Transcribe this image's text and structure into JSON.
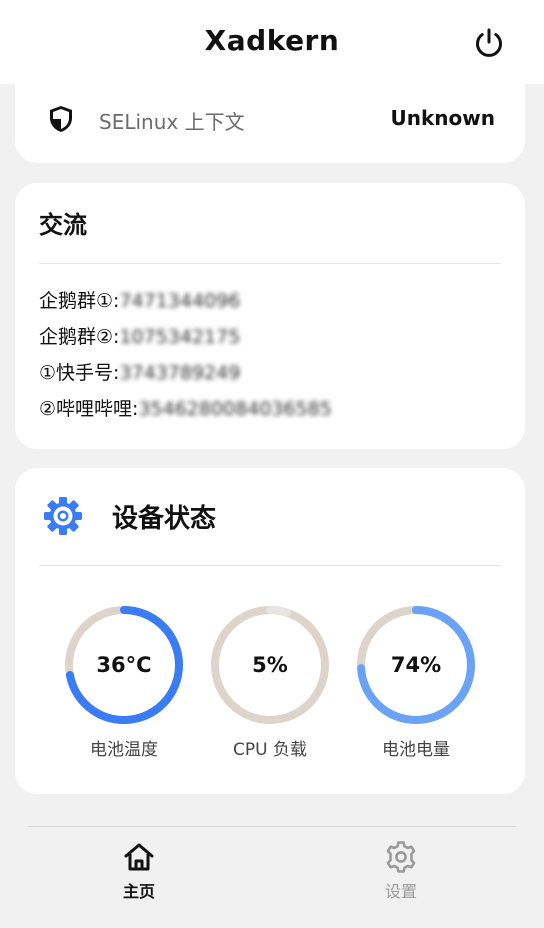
{
  "app": {
    "title": "Xadkern"
  },
  "selinux": {
    "label": "SELinux 上下文",
    "value": "Unknown",
    "icon": "shield-icon"
  },
  "communication": {
    "title": "交流",
    "items": [
      {
        "label": "企鹅群①:",
        "value": "7471344096"
      },
      {
        "label": "企鹅群②:",
        "value": "1075342175"
      },
      {
        "label": "①快手号:",
        "value": "3743789249"
      },
      {
        "label": "②哔哩哔哩:",
        "value": "3546280084036585"
      }
    ]
  },
  "device_status": {
    "title": "设备状态",
    "icon": "gear-icon",
    "gauges": [
      {
        "label": "电池温度",
        "display": "36°C",
        "fraction": 0.72,
        "color": "#3a7cf3",
        "track": "#ddd4cc"
      },
      {
        "label": "CPU 负载",
        "display": "5%",
        "fraction": 0.05,
        "color": "#e8e4e1",
        "track": "#ddd4cc"
      },
      {
        "label": "电池电量",
        "display": "74%",
        "fraction": 0.74,
        "color": "#6aa3f6",
        "track": "#ddd4cc"
      }
    ]
  },
  "bottom_nav": {
    "items": [
      {
        "label": "主页",
        "icon": "home-icon",
        "active": true
      },
      {
        "label": "设置",
        "icon": "settings-gear-icon",
        "active": false
      }
    ]
  }
}
